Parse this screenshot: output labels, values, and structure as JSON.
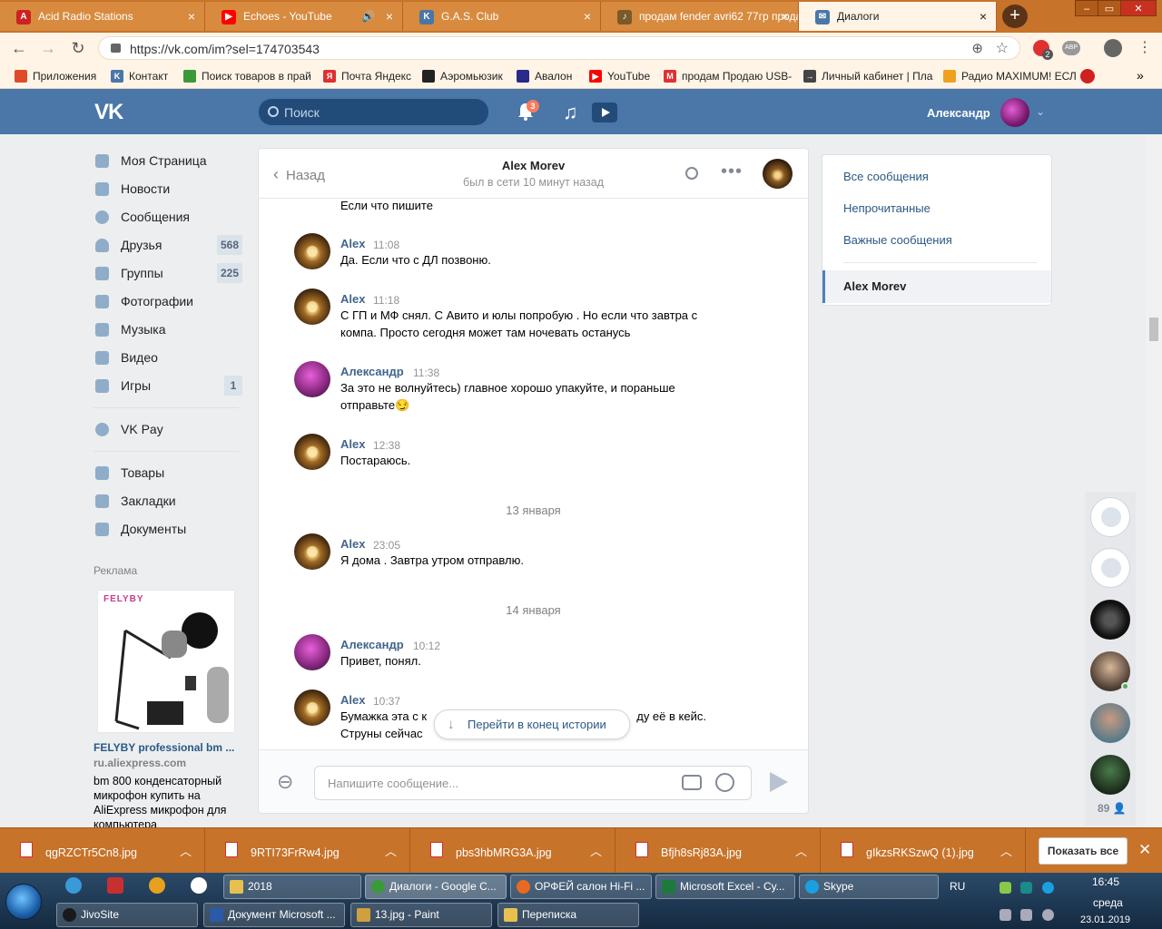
{
  "browser": {
    "tabs": [
      {
        "title": "Acid Radio Stations",
        "icon_color": "#cc2222"
      },
      {
        "title": "Echoes - YouTube",
        "icon_color": "#ff0000"
      },
      {
        "title": "G.A.S. Club",
        "icon_color": "#4a76a8"
      },
      {
        "title": "продам fender avri62 77гр продам",
        "icon_color": "#7a5a2a"
      },
      {
        "title": "Диалоги",
        "icon_color": "#4a76a8"
      }
    ],
    "new_tab_label": "+",
    "url": "https://vk.com/im?sel=174703543",
    "bookmarks": [
      {
        "label": "Приложения",
        "icon_color": "#e04a2a"
      },
      {
        "label": "Контакт",
        "icon_color": "#4a76a8"
      },
      {
        "label": "Поиск товаров в прай",
        "icon_color": "#3a9a3a"
      },
      {
        "label": "Почта Яндекс",
        "icon_color": "#e03030"
      },
      {
        "label": "Аэромьюзик",
        "icon_color": "#222222"
      },
      {
        "label": "Авалон",
        "icon_color": "#2a2a8a"
      },
      {
        "label": "YouTube",
        "icon_color": "#ff0000"
      },
      {
        "label": "продам Продаю USB-",
        "icon_color": "#e03030"
      },
      {
        "label": "Личный кабинет | Пла",
        "icon_color": "#444444"
      },
      {
        "label": "Радио MAXIMUM! ЕСЛ",
        "icon_color": "#f0a020"
      }
    ],
    "bookmarks_more": "»",
    "extension_badge": "2",
    "ext_abr_label": "АВР"
  },
  "vk_header": {
    "logo": "VK",
    "search_placeholder": "Поиск",
    "notifications_count": "3",
    "user_name": "Александр",
    "user_chevron": "⌄"
  },
  "left_menu": {
    "items": [
      {
        "label": "Моя Страница",
        "count": ""
      },
      {
        "label": "Новости",
        "count": ""
      },
      {
        "label": "Сообщения",
        "count": ""
      },
      {
        "label": "Друзья",
        "count": "568"
      },
      {
        "label": "Группы",
        "count": "225"
      },
      {
        "label": "Фотографии",
        "count": ""
      },
      {
        "label": "Музыка",
        "count": ""
      },
      {
        "label": "Видео",
        "count": ""
      },
      {
        "label": "Игры",
        "count": "1"
      }
    ],
    "vkpay": "VK Pay",
    "items2": [
      "Товары",
      "Закладки",
      "Документы"
    ],
    "ad_label": "Реклама",
    "ad_brand": "FELYBY",
    "ad_title": "FELYBY professional bm ...",
    "ad_url": "ru.aliexpress.com",
    "ad_text": "bm 800 конденсаторный микрофон купить на AliExpress микрофон для компьютера"
  },
  "chat": {
    "back_label": "Назад",
    "name": "Alex Morev",
    "status": "был в сети 10 минут назад",
    "top_line": "Если что пишите",
    "messages": [
      {
        "author": "Alex",
        "time": "11:08",
        "text": "Да. Если что с ДЛ позвоню."
      },
      {
        "author": "Alex",
        "time": "11:18",
        "text": "С ГП и МФ снял. С Авито и юлы попробую . Но если что завтра с компа. Просто сегодня может там ночевать останусь"
      },
      {
        "author": "Александр",
        "time": "11:38",
        "text": "За это не волнуйтесь) главное хорошо упакуйте, и пораньше отправьте😏"
      },
      {
        "author": "Alex",
        "time": "12:38",
        "text": "Постараюсь."
      },
      {
        "author": "Alex",
        "time": "23:05",
        "text": "Я дома . Завтра утром отправлю."
      },
      {
        "author": "Александр",
        "time": "10:12",
        "text": "Привет, понял."
      },
      {
        "author": "Alex",
        "time": "10:37",
        "text": "Бумажка эта с к                                                                ду её в кейс. Струны сейчас"
      }
    ],
    "date_separators": [
      "13 января",
      "14 января"
    ],
    "goto_end": "Перейти в конец истории",
    "input_placeholder": "Напишите сообщение..."
  },
  "right_panel": {
    "links": [
      "Все сообщения",
      "Непрочитанные",
      "Важные сообщения"
    ],
    "active_dialog": "Alex Morev"
  },
  "dock": {
    "count": "89"
  },
  "downloads": {
    "files": [
      "qgRZCTr5Cn8.jpg",
      "9RTI73FrRw4.jpg",
      "pbs3hbMRG3A.jpg",
      "Bfjh8sRj83A.jpg",
      "gIkzsRKSzwQ (1).jpg"
    ],
    "show_all": "Показать все"
  },
  "taskbar": {
    "row1": [
      {
        "label": "2018",
        "icon_color": "#e8c050"
      },
      {
        "label": "Диалоги - Google C...",
        "icon_color": "#3a9a3a"
      },
      {
        "label": "ОРФЕЙ салон Hi-Fi ...",
        "icon_color": "#e86a20"
      },
      {
        "label": "Microsoft Excel - Су...",
        "icon_color": "#1e7a3a"
      },
      {
        "label": "Skype",
        "icon_color": "#1aa0e0"
      }
    ],
    "row2": [
      {
        "label": "JivoSite",
        "icon_color": "#1a1a1a"
      },
      {
        "label": "Документ Microsoft ...",
        "icon_color": "#2a5aa8"
      },
      {
        "label": "13.jpg - Paint",
        "icon_color": "#d0a040"
      },
      {
        "label": "Переписка",
        "icon_color": "#e8c050"
      }
    ],
    "lang": "RU",
    "time": "16:45",
    "day": "среда",
    "date": "23.01.2019"
  }
}
